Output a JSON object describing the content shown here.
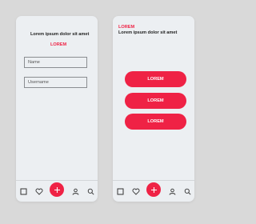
{
  "left_screen": {
    "heading": "Lorem ipsum dolor sit amet",
    "accent_title": "LOREM",
    "name_field_placeholder": "Name",
    "username_field_placeholder": "Username"
  },
  "right_screen": {
    "accent_title": "LOREM",
    "heading": "Lorem ipsum dolor sit amet",
    "buttons": [
      "LOREM",
      "LOREM",
      "LOREM"
    ]
  },
  "tab_bar_icons": [
    "square-icon",
    "heart-icon",
    "plus-icon",
    "user-icon",
    "search-icon"
  ],
  "colors": {
    "accent": "#ef2245",
    "screen_background": "#eceff2",
    "page_background": "#d9d9d9"
  }
}
